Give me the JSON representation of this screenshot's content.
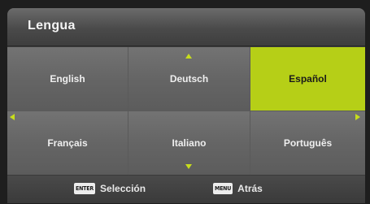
{
  "title": "Lengua",
  "languages": [
    {
      "label": "English"
    },
    {
      "label": "Deutsch"
    },
    {
      "label": "Español",
      "selected": true
    },
    {
      "label": "Français"
    },
    {
      "label": "Italiano"
    },
    {
      "label": "Português"
    }
  ],
  "footer": {
    "enter_key": "ENTER",
    "enter_label": "Selección",
    "menu_key": "MENU",
    "menu_label": "Atrás"
  },
  "colors": {
    "accent": "#b6cf17",
    "arrow": "#c7dd1c"
  }
}
